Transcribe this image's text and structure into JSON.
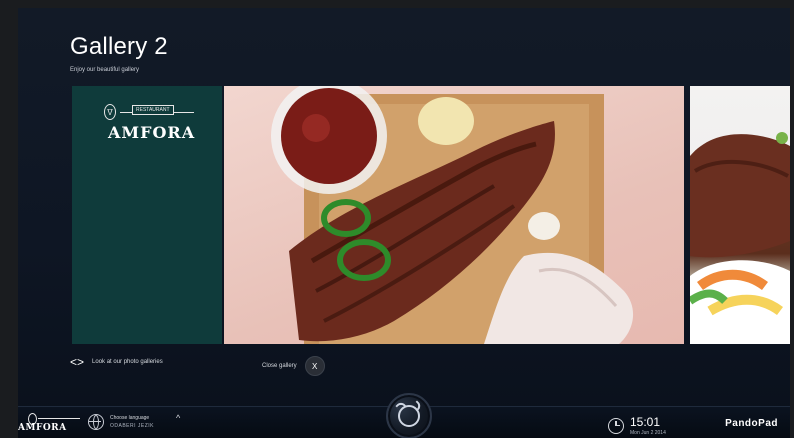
{
  "gallery": {
    "title": "Gallery 2",
    "subtitle": "Enjoy our beautiful gallery"
  },
  "branding": {
    "restaurant_tag": "RESTAURANT",
    "restaurant_name": "AMFORA",
    "app_brand": "PandoPad"
  },
  "controls": {
    "photo_galleries_text": "Look at our photo galleries",
    "close_gallery_text": "Close gallery",
    "close_symbol": "X",
    "nav_arrows": "<>"
  },
  "bottombar": {
    "choose_language_label": "Choose language",
    "choose_language_value": "ODABERI JEZIK",
    "caret": "^",
    "time": "15:01",
    "date": "Mon Jun 2 2014"
  },
  "icons": {
    "globe": "globe-icon",
    "clock": "clock-icon",
    "center": "tie-icon"
  },
  "colors": {
    "background": "#121a27",
    "logo_card": "#0f3b3b",
    "text_primary": "#ffffff"
  }
}
